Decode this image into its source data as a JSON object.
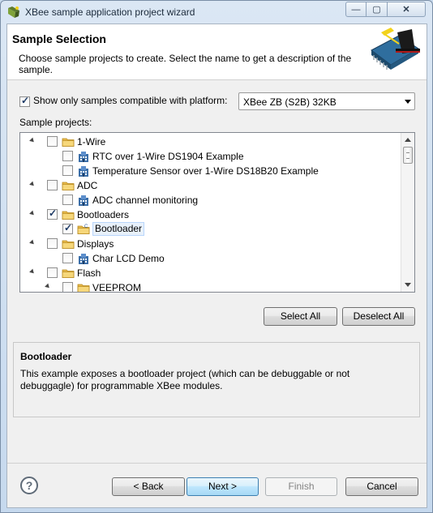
{
  "window": {
    "title": "XBee sample application project wizard",
    "controls": {
      "minimize": "—",
      "maximize": "▢",
      "close": "✕"
    }
  },
  "header": {
    "title": "Sample Selection",
    "description": "Choose sample projects to create. Select the name to get a description of the sample.",
    "logo_icon": "xbee-module-logo-icon"
  },
  "compat": {
    "label": "Show only samples compatible with platform:",
    "checked": true
  },
  "platform": {
    "selected": "XBee ZB (S2B) 32KB"
  },
  "sample_projects_label": "Sample projects:",
  "tree": [
    {
      "label": "1-Wire",
      "type": "folder",
      "level": 0,
      "expanded": true,
      "checked": false
    },
    {
      "label": "RTC over 1-Wire DS1904 Example",
      "type": "project",
      "level": 1,
      "checked": false
    },
    {
      "label": "Temperature Sensor over 1-Wire DS18B20 Example",
      "type": "project",
      "level": 1,
      "checked": false
    },
    {
      "label": "ADC",
      "type": "folder",
      "level": 0,
      "expanded": true,
      "checked": false
    },
    {
      "label": "ADC channel monitoring",
      "type": "project",
      "level": 1,
      "checked": false
    },
    {
      "label": "Bootloaders",
      "type": "folder",
      "level": 0,
      "expanded": true,
      "checked": true
    },
    {
      "label": "Bootloader",
      "type": "source-folder",
      "level": 1,
      "checked": true,
      "selected": true
    },
    {
      "label": "Displays",
      "type": "folder",
      "level": 0,
      "expanded": true,
      "checked": false
    },
    {
      "label": "Char LCD Demo",
      "type": "project",
      "level": 1,
      "checked": false
    },
    {
      "label": "Flash",
      "type": "folder",
      "level": 0,
      "expanded": true,
      "checked": false
    },
    {
      "label": "VEEPROM",
      "type": "folder",
      "level": 1,
      "expanded": true,
      "checked": false
    }
  ],
  "buttons": {
    "select_all": "Select All",
    "deselect_all": "Deselect All",
    "back": "< Back",
    "next": "Next >",
    "finish": "Finish",
    "cancel": "Cancel",
    "help": "?"
  },
  "description": {
    "title": "Bootloader",
    "text": "This example exposes a bootloader project (which can be debuggable or not debuggagle) for programmable XBee modules."
  },
  "colors": {
    "folder": "#e8b94a",
    "project": "#3b6ea8",
    "selection_bg": "#e8f1fb",
    "primary_button": "#bee6fd"
  }
}
